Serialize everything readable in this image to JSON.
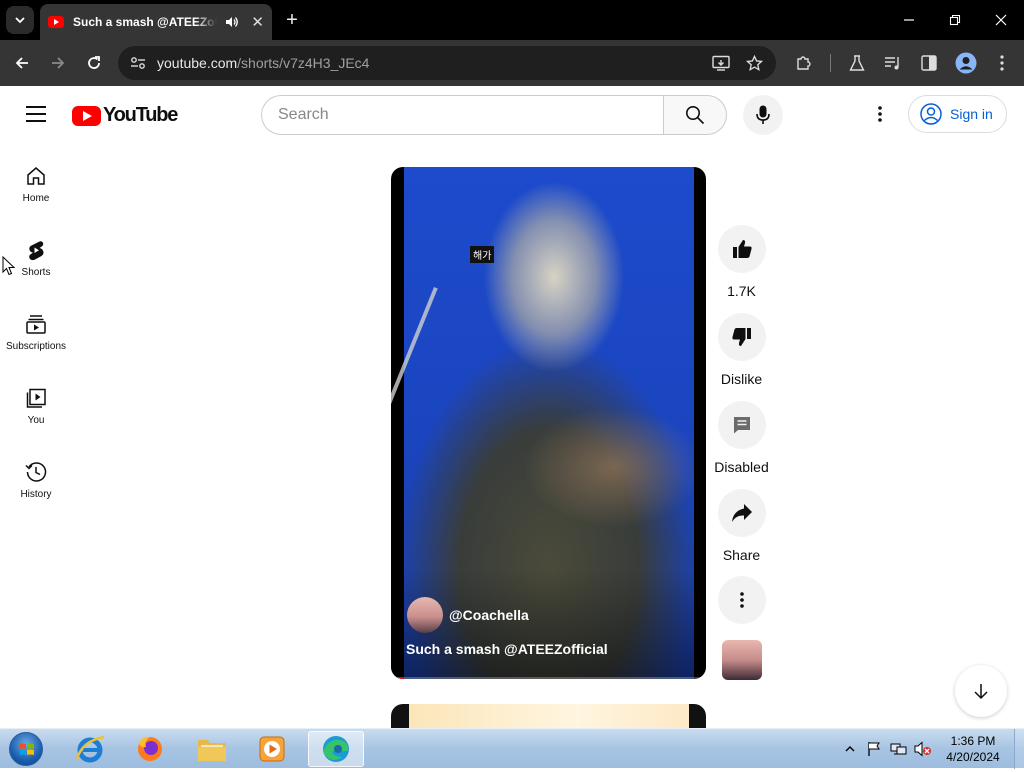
{
  "browser": {
    "tab": {
      "title": "Such a smash @ATEEZofficial",
      "close": "✕"
    },
    "new_tab": "+",
    "address": {
      "domain": "youtube.com",
      "path": "/shorts/v7z4H3_JEc4"
    }
  },
  "youtube": {
    "logo_text": "YouTube",
    "search": {
      "placeholder": "Search"
    },
    "sign_in": "Sign in",
    "guide": [
      {
        "label": "Home",
        "icon": "home-icon"
      },
      {
        "label": "Shorts",
        "icon": "shorts-icon"
      },
      {
        "label": "Subscriptions",
        "icon": "subscriptions-icon"
      },
      {
        "label": "You",
        "icon": "you-icon"
      },
      {
        "label": "History",
        "icon": "history-icon"
      }
    ],
    "short": {
      "caption_tag": "해가",
      "channel": "@Coachella",
      "title": "Such a smash @ATEEZofficial"
    },
    "actions": {
      "like": "1.7K",
      "dislike": "Dislike",
      "comments": "Disabled",
      "share": "Share"
    }
  },
  "taskbar": {
    "time": "1:36 PM",
    "date": "4/20/2024"
  },
  "colors": {
    "youtube_red": "#ff0000",
    "link_blue": "#065fd4",
    "chrome_dark": "#353535"
  }
}
